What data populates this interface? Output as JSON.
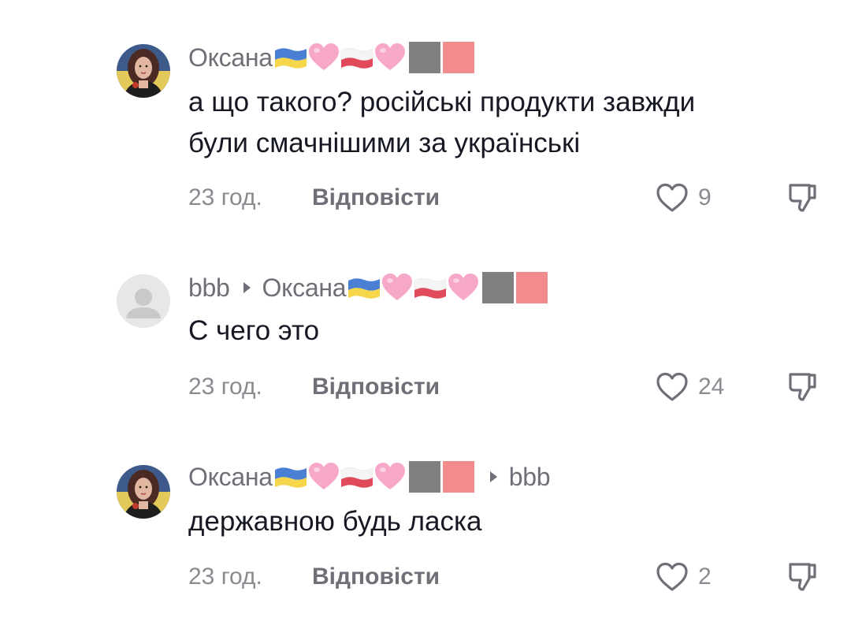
{
  "comments": [
    {
      "username": "Оксана",
      "username_emojis": [
        "ukraine-flag",
        "pink-heart",
        "poland-flag",
        "pink-heart",
        "grey-square",
        "pink-square"
      ],
      "text_lines": [
        "а що такого? російські продукти завжди",
        "були смачнішими за українські"
      ],
      "time": "23 год.",
      "reply_label": "Відповісти",
      "likes": "9"
    },
    {
      "username": "bbb",
      "reply_to": "Оксана",
      "reply_to_emojis": [
        "ukraine-flag",
        "pink-heart",
        "poland-flag",
        "pink-heart",
        "grey-square",
        "pink-square"
      ],
      "text_lines": [
        "С чего это"
      ],
      "time": "23 год.",
      "reply_label": "Відповісти",
      "likes": "24"
    },
    {
      "username": "Оксана",
      "username_emojis": [
        "ukraine-flag",
        "pink-heart",
        "poland-flag",
        "pink-heart",
        "grey-square",
        "pink-square"
      ],
      "reply_to": "bbb",
      "text_lines": [
        "державною будь ласка"
      ],
      "time": "23 год.",
      "reply_label": "Відповісти",
      "likes": "2"
    }
  ],
  "colors": {
    "username": "#6f7077",
    "text": "#161823",
    "muted": "#8a8b91",
    "heart_emoji": "#f7a8c8",
    "grey_square": "#808080",
    "pink_square": "#f28b8b",
    "ukraine_blue": "#4a7fd4",
    "ukraine_yellow": "#f6d64a",
    "poland_red": "#e04a5a"
  },
  "icons": {
    "like": "heart-outline-icon",
    "dislike": "thumbs-down-outline-icon",
    "reply_separator": "triangle-right-icon"
  }
}
